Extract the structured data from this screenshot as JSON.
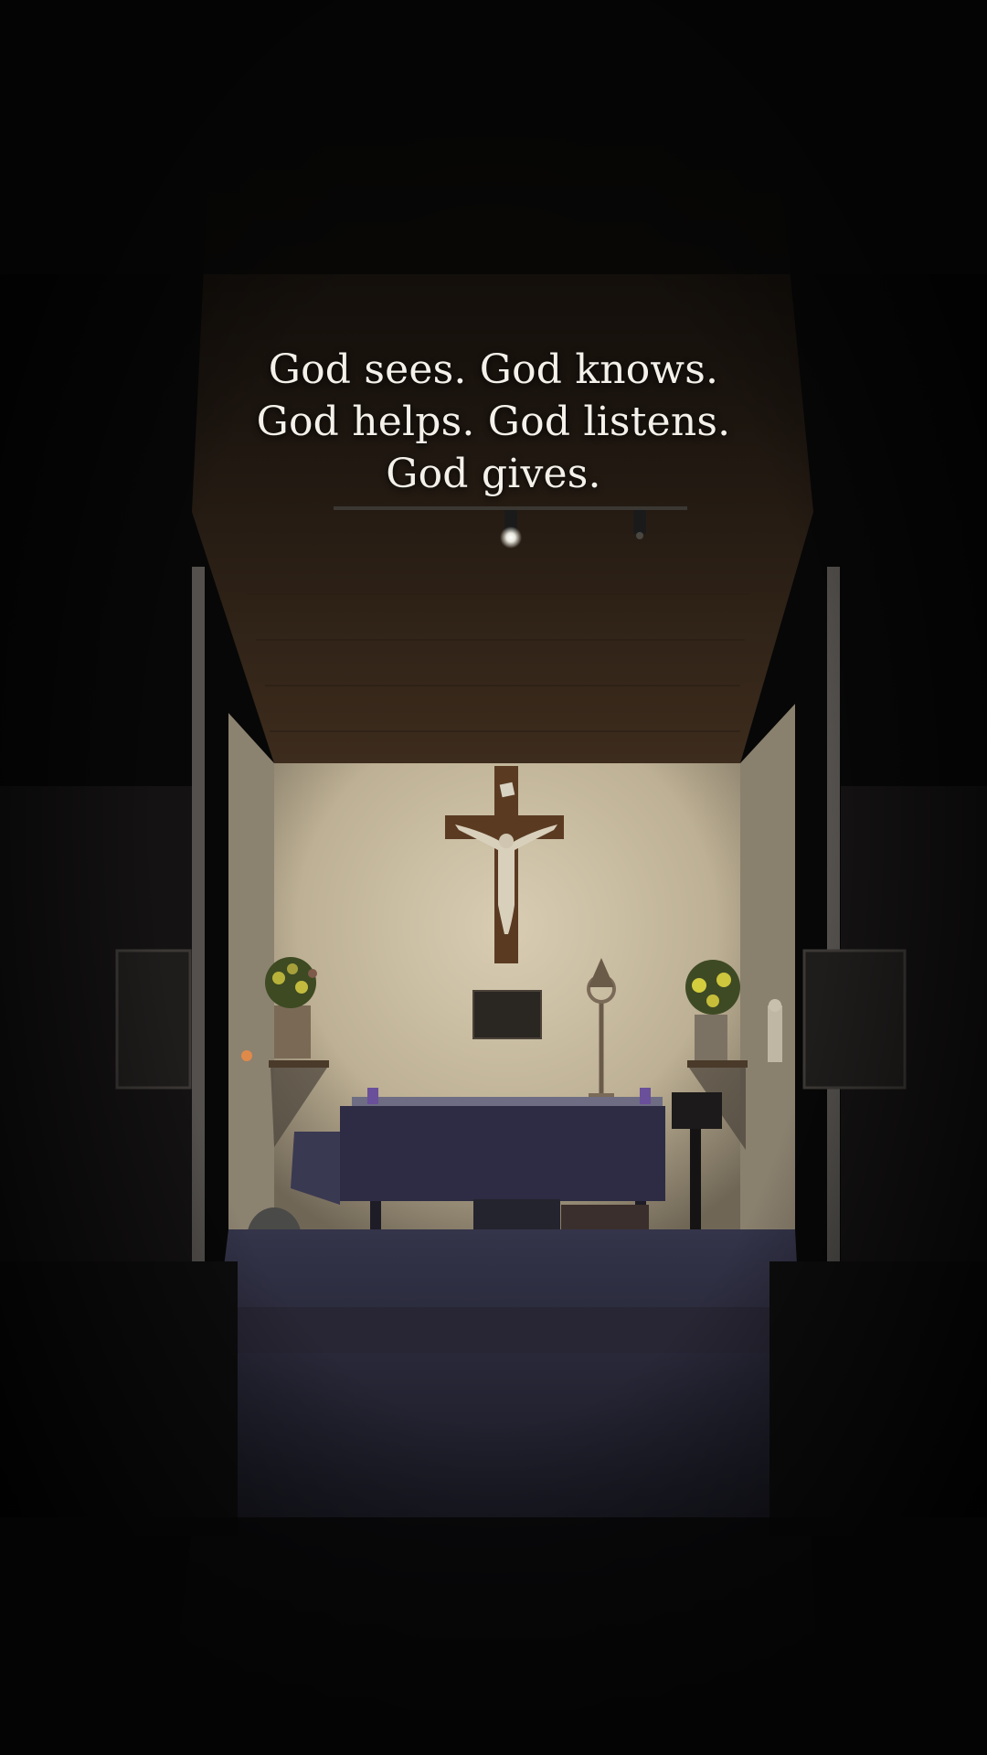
{
  "overlay": {
    "lines": [
      "God sees. God knows.",
      "God helps. God listens.",
      "God gives."
    ]
  },
  "colors": {
    "background": "#060606",
    "wall": "#cfc3a9",
    "ceiling": "#3a2a1c",
    "altar_cloth": "#2d2c44",
    "caption_text": "#f4f1ea"
  }
}
